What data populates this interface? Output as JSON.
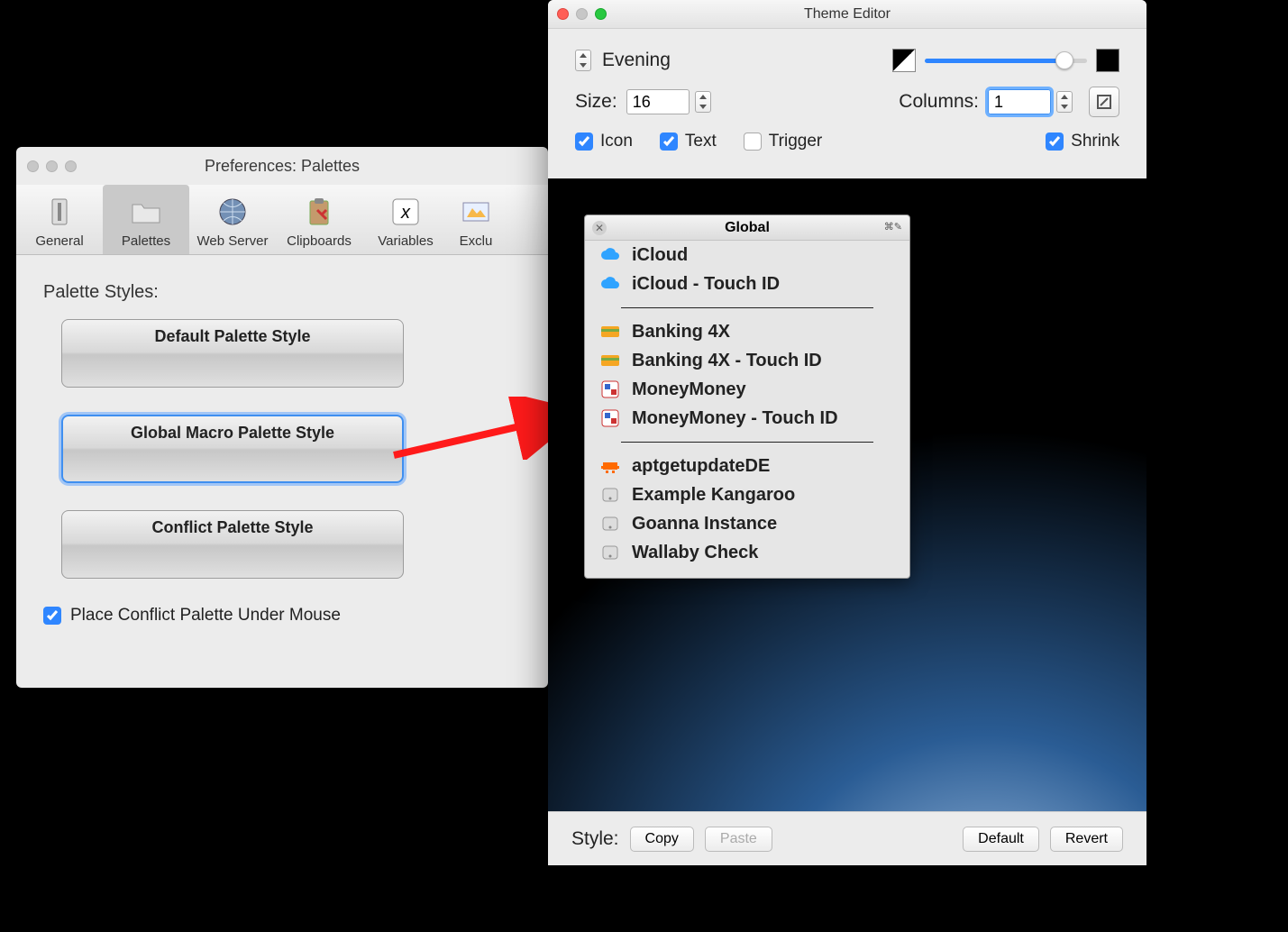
{
  "prefs": {
    "title": "Preferences: Palettes",
    "tabs": [
      "General",
      "Palettes",
      "Web Server",
      "Clipboards",
      "Variables",
      "Exclu"
    ],
    "selected_tab": 1,
    "section_label": "Palette Styles:",
    "styles": [
      {
        "label": "Default Palette Style",
        "selected": false
      },
      {
        "label": "Global Macro Palette Style",
        "selected": true
      },
      {
        "label": "Conflict Palette Style",
        "selected": false
      }
    ],
    "checkbox_label": "Place Conflict Palette Under Mouse",
    "checkbox_checked": true
  },
  "theme": {
    "title": "Theme Editor",
    "preset_name": "Evening",
    "size_label": "Size:",
    "size_value": "16",
    "columns_label": "Columns:",
    "columns_value": "1",
    "icon_label": "Icon",
    "text_label": "Text",
    "trigger_label": "Trigger",
    "shrink_label": "Shrink",
    "icon_checked": true,
    "text_checked": true,
    "trigger_checked": false,
    "shrink_checked": true,
    "colors": {
      "start": "#000000/#FFFFFF",
      "end": "#000000"
    }
  },
  "palette": {
    "title": "Global",
    "groups": [
      [
        {
          "icon": "cloud-icon",
          "label": "iCloud"
        },
        {
          "icon": "cloud-icon",
          "label": "iCloud - Touch ID"
        }
      ],
      [
        {
          "icon": "card-icon",
          "label": "Banking 4X"
        },
        {
          "icon": "card-icon",
          "label": "Banking 4X - Touch ID"
        },
        {
          "icon": "app-icon",
          "label": "MoneyMoney"
        },
        {
          "icon": "app-icon",
          "label": "MoneyMoney - Touch ID"
        }
      ],
      [
        {
          "icon": "alien-icon",
          "label": "aptgetupdateDE"
        },
        {
          "icon": "drive-icon",
          "label": "Example Kangaroo"
        },
        {
          "icon": "drive-icon",
          "label": "Goanna Instance"
        },
        {
          "icon": "drive-icon",
          "label": "Wallaby Check"
        }
      ]
    ]
  },
  "bottom": {
    "style_label": "Style:",
    "copy": "Copy",
    "paste": "Paste",
    "default": "Default",
    "revert": "Revert"
  }
}
